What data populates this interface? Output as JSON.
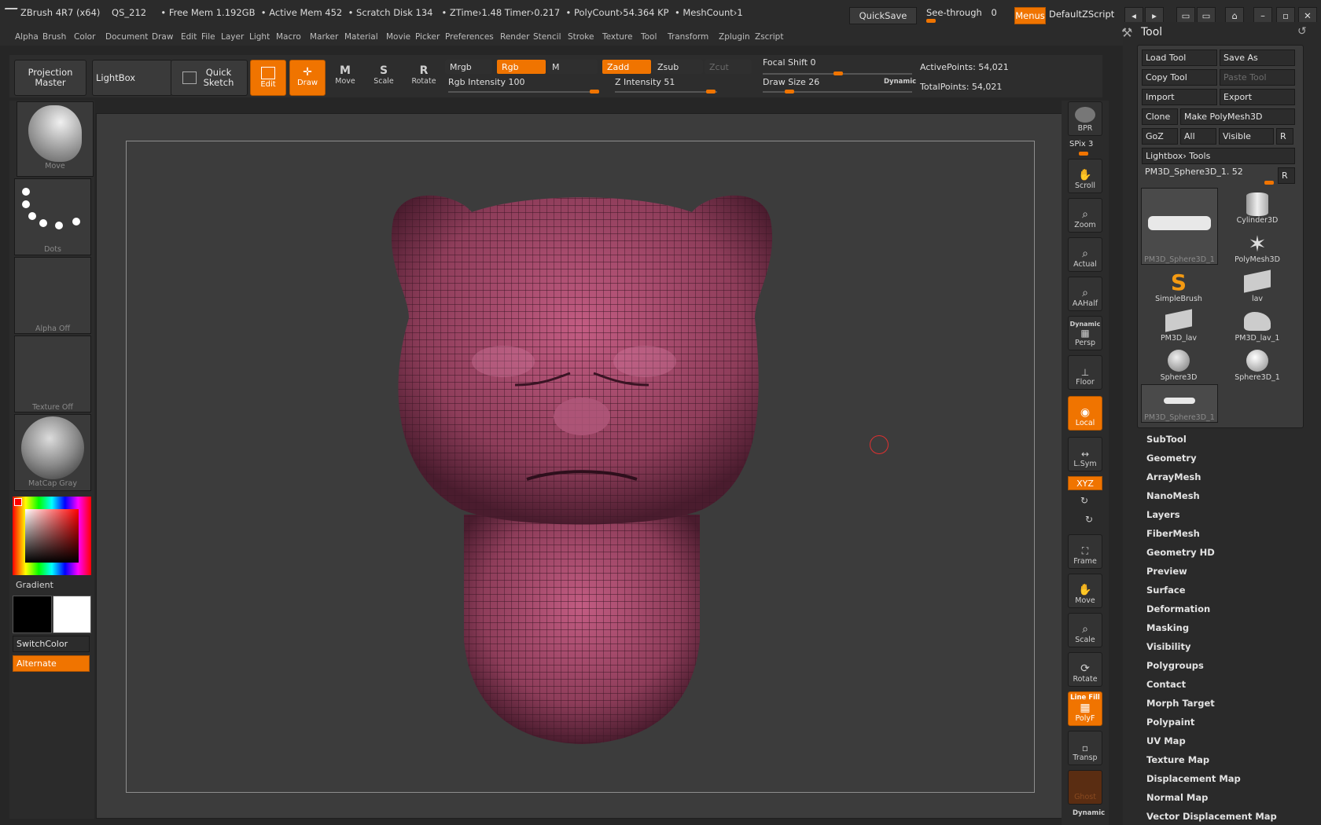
{
  "titlebar": {
    "app": "ZBrush 4R7 (x64)",
    "doc": "QS_212",
    "free_mem": "• Free Mem 1.192GB",
    "active_mem": "• Active Mem 452",
    "scratch": "• Scratch Disk 134",
    "ztime": "• ZTime›1.48 Timer›0.217",
    "polycount": "• PolyCount›54.364 KP",
    "meshcount": "• MeshCount›1",
    "quicksave": "QuickSave",
    "see_through_label": "See-through",
    "see_through_value": "0",
    "menus": "Menus",
    "script": "DefaultZScript"
  },
  "menu": [
    "Alpha",
    "Brush",
    "Color",
    "Document",
    "Draw",
    "Edit",
    "File",
    "Layer",
    "Light",
    "Macro",
    "Marker",
    "Material",
    "Movie",
    "Picker",
    "Preferences",
    "Render",
    "Stencil",
    "Stroke",
    "Texture",
    "Tool",
    "Transform",
    "Zplugin",
    "Zscript"
  ],
  "toolbar": {
    "projection_master": "Projection Master",
    "lightbox": "LightBox",
    "quick_sketch": "Quick Sketch",
    "edit": "Edit",
    "draw": "Draw",
    "move": "Move",
    "scale": "Scale",
    "rotate": "Rotate",
    "mrgb": "Mrgb",
    "rgb": "Rgb",
    "m": "M",
    "zadd": "Zadd",
    "zsub": "Zsub",
    "zcut": "Zcut",
    "rgb_intensity": "Rgb Intensity 100",
    "z_intensity": "Z Intensity 51",
    "focal_shift": "Focal Shift 0",
    "draw_size": "Draw Size 26",
    "dynamic": "Dynamic",
    "active_points": "ActivePoints: 54,021",
    "total_points": "TotalPoints: 54,021"
  },
  "left": {
    "brush": "Move",
    "stroke": "Dots",
    "alpha": "Alpha Off",
    "texture": "Texture Off",
    "material": "MatCap Gray",
    "gradient": "Gradient",
    "switchcolor": "SwitchColor",
    "alternate": "Alternate"
  },
  "shelf": {
    "bpr": "BPR",
    "spix": "SPix 3",
    "scroll": "Scroll",
    "zoom": "Zoom",
    "actual": "Actual",
    "aahalf": "AAHalf",
    "dynamic": "Dynamic",
    "persp": "Persp",
    "floor": "Floor",
    "local": "Local",
    "lsym": "L.Sym",
    "xyz": "XYZ",
    "frame": "Frame",
    "move": "Move",
    "scale": "Scale",
    "rotate": "Rotate",
    "linefill": "Line Fill",
    "polyf": "PolyF",
    "transp": "Transp",
    "ghost": "Ghost",
    "dynamic2": "Dynamic"
  },
  "tool": {
    "title": "Tool",
    "load": "Load Tool",
    "save_as": "Save As",
    "copy": "Copy Tool",
    "paste": "Paste Tool",
    "import": "Import",
    "export": "Export",
    "clone": "Clone",
    "make_poly": "Make PolyMesh3D",
    "goz": "GoZ",
    "all": "All",
    "visible": "Visible",
    "r": "R",
    "lightbox_tools": "Lightbox› Tools",
    "current": "PM3D_Sphere3D_1. 52",
    "items": [
      "PM3D_Sphere3D_1",
      "Cylinder3D",
      "PolyMesh3D",
      "SimpleBrush",
      "lav",
      "PM3D_lav",
      "PM3D_lav_1",
      "Sphere3D",
      "Sphere3D_1",
      "PM3D_Sphere3D_1"
    ],
    "subpalettes": [
      "SubTool",
      "Geometry",
      "ArrayMesh",
      "NanoMesh",
      "Layers",
      "FiberMesh",
      "Geometry HD",
      "Preview",
      "Surface",
      "Deformation",
      "Masking",
      "Visibility",
      "Polygroups",
      "Contact",
      "Morph Target",
      "Polypaint",
      "UV Map",
      "Texture Map",
      "Displacement Map",
      "Normal Map",
      "Vector Displacement Map"
    ]
  },
  "colors": {
    "accent": "#f07400",
    "mesh": "#a34a68"
  }
}
